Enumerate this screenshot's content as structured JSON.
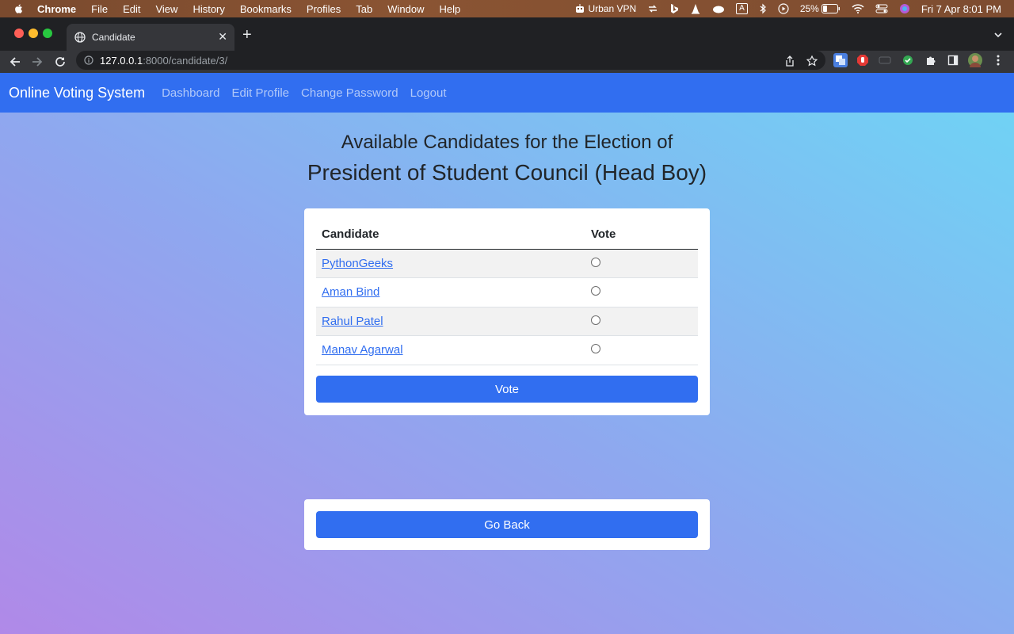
{
  "menubar": {
    "app": "Chrome",
    "items": [
      "File",
      "Edit",
      "View",
      "History",
      "Bookmarks",
      "Profiles",
      "Tab",
      "Window",
      "Help"
    ],
    "vpn_label": "Urban VPN",
    "battery": "25%",
    "input_indicator": "A",
    "datetime": "Fri 7 Apr  8:01 PM"
  },
  "browser": {
    "tab_title": "Candidate",
    "url_host": "127.0.0.1",
    "url_path": ":8000/candidate/3/"
  },
  "app": {
    "brand": "Online Voting System",
    "nav": [
      "Dashboard",
      "Edit Profile",
      "Change Password",
      "Logout"
    ],
    "nav_color": "#316ef0"
  },
  "main": {
    "heading_line1": "Available Candidates for the Election of",
    "heading_line2": "President of Student Council (Head Boy)",
    "table": {
      "headers": [
        "Candidate",
        "Vote"
      ],
      "candidates": [
        "PythonGeeks",
        "Aman Bind",
        "Rahul Patel",
        "Manav Agarwal"
      ]
    },
    "vote_button": "Vote",
    "back_button": "Go Back"
  }
}
